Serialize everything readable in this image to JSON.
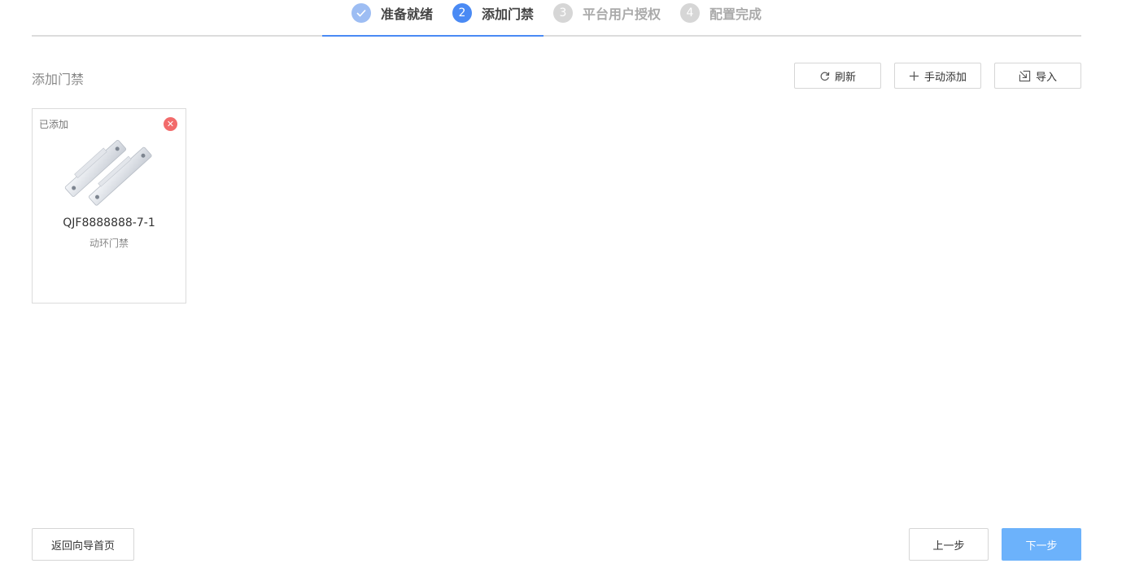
{
  "steps": [
    {
      "number": "",
      "label": "准备就绪",
      "state": "done"
    },
    {
      "number": "2",
      "label": "添加门禁",
      "state": "active"
    },
    {
      "number": "3",
      "label": "平台用户授权",
      "state": "todo"
    },
    {
      "number": "4",
      "label": "配置完成",
      "state": "todo"
    }
  ],
  "section": {
    "title": "添加门禁"
  },
  "toolbar": {
    "refresh_label": "刷新",
    "manual_add_label": "手动添加",
    "import_label": "导入"
  },
  "devices": [
    {
      "status": "已添加",
      "name": "QJF8888888-7-1",
      "type": "动环门禁"
    }
  ],
  "footer": {
    "back_label": "返回向导首页",
    "prev_label": "上一步",
    "next_label": "下一步"
  },
  "colors": {
    "accent": "#4a8af4",
    "done": "#9dbdf3",
    "todo": "#d6d6d6",
    "danger": "#f26b6b",
    "next_button": "#6cb2fb"
  }
}
